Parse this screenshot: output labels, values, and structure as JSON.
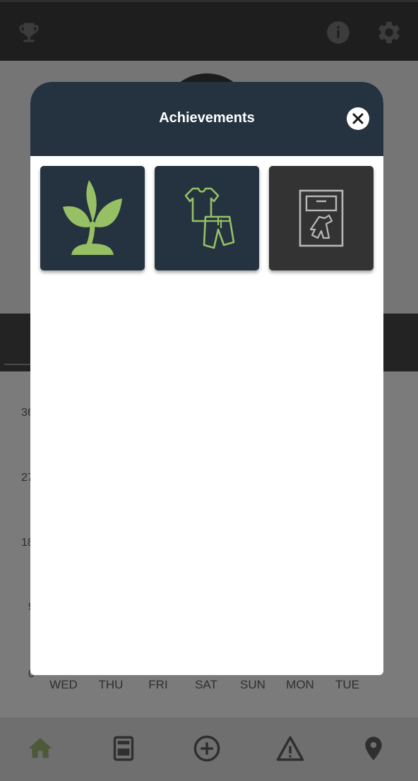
{
  "colors": {
    "modal_header": "#24333f",
    "badge_unlocked": "#24333f",
    "badge_locked": "#333333",
    "accent_green": "#97c065"
  },
  "top_bar": {
    "icons": [
      "trophy-icon",
      "info-icon",
      "settings-icon"
    ]
  },
  "chart": {
    "y_ticks": [
      "36",
      "27",
      "18",
      "9",
      "0"
    ],
    "x_days": [
      "WED",
      "THU",
      "FRI",
      "SAT",
      "SUN",
      "MON",
      "TUE"
    ]
  },
  "bottom_nav": {
    "items": [
      "home-icon",
      "calendar-icon",
      "add-circle-icon",
      "warning-icon",
      "location-pin-icon"
    ]
  },
  "modal": {
    "title": "Achievements",
    "badges": [
      {
        "icon": "plant-sprout-icon",
        "state": "unlocked"
      },
      {
        "icon": "clothing-icon",
        "state": "unlocked"
      },
      {
        "icon": "washing-machine-icon",
        "state": "locked"
      }
    ]
  }
}
